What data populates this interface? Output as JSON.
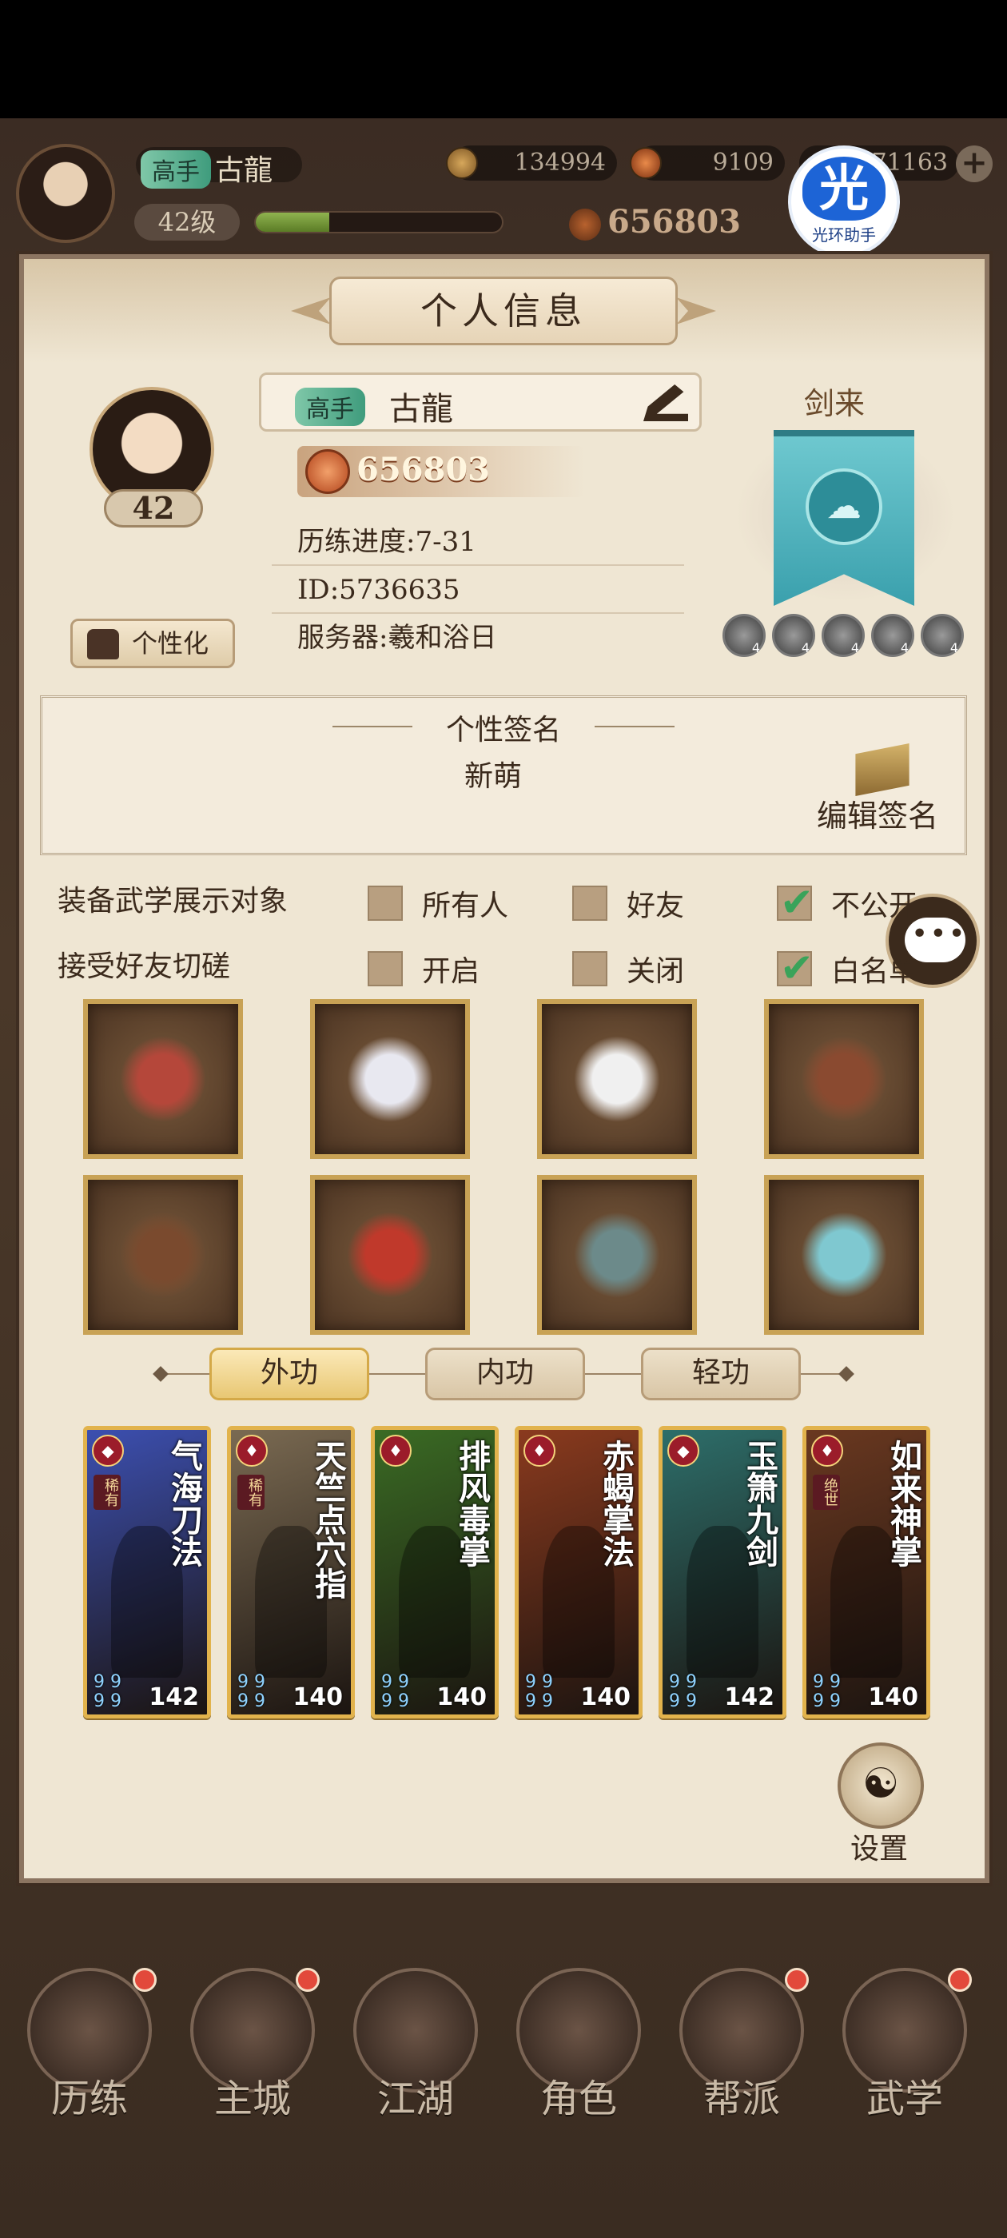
{
  "hud": {
    "rank_badge": "高手",
    "player_name": "古龍",
    "level": "42级",
    "exp_fraction": 0.3,
    "coins": "134994",
    "gems": "9109",
    "tokens": "71163",
    "power": "656803",
    "helper_glyph": "光",
    "helper_label": "光环助手"
  },
  "panel": {
    "title": "个人信息",
    "avatar_level": "42",
    "customize_label": "个性化",
    "rank_badge": "高手",
    "name": "古龍",
    "power": "656803",
    "progress": "历练进度:7-31",
    "id": "ID:5736635",
    "server": "服务器:羲和浴日",
    "sect": {
      "name": "剑来",
      "skill_levels": [
        "4",
        "4",
        "4",
        "4",
        "4"
      ]
    },
    "signature": {
      "title": "个性签名",
      "text": "新萌",
      "edit_label": "编辑签名"
    },
    "options": [
      {
        "label": "装备武学展示对象",
        "choices": [
          {
            "text": "所有人",
            "checked": false
          },
          {
            "text": "好友",
            "checked": false
          },
          {
            "text": "不公开",
            "checked": true
          }
        ]
      },
      {
        "label": "接受好友切磋",
        "choices": [
          {
            "text": "开启",
            "checked": false
          },
          {
            "text": "关闭",
            "checked": false
          },
          {
            "text": "白名单",
            "checked": true
          }
        ]
      }
    ],
    "equipment": [
      "bracer-icon",
      "robe-icon",
      "belt-icon",
      "boots-icon",
      "necklace-icon",
      "hairpin-icon",
      "bracelet-icon",
      "ring-icon"
    ],
    "tabs": [
      {
        "label": "外功",
        "active": true
      },
      {
        "label": "内功",
        "active": false
      },
      {
        "label": "轻功",
        "active": false
      }
    ],
    "cards": [
      {
        "name": "气海刀法",
        "tag": "稀有",
        "level": "142",
        "color": "#3c4fb0"
      },
      {
        "name": "天竺点穴指",
        "tag": "稀有",
        "level": "140",
        "color": "#7a6a52"
      },
      {
        "name": "排风毒掌",
        "tag": "",
        "level": "140",
        "color": "#3a6b24"
      },
      {
        "name": "赤蝎掌法",
        "tag": "",
        "level": "140",
        "color": "#8a3a1e"
      },
      {
        "name": "玉箫九剑",
        "tag": "",
        "level": "142",
        "color": "#2d6e6a"
      },
      {
        "name": "如来神掌",
        "tag": "绝世",
        "level": "140",
        "color": "#6a3820"
      }
    ],
    "settings_label": "设置"
  },
  "nav": [
    {
      "label": "历练",
      "badge": true
    },
    {
      "label": "主城",
      "badge": true
    },
    {
      "label": "江湖",
      "badge": false
    },
    {
      "label": "角色",
      "badge": false
    },
    {
      "label": "帮派",
      "badge": true
    },
    {
      "label": "武学",
      "badge": true
    }
  ],
  "colors": {
    "panel_bg": "#efe6d3",
    "accent_gold": "#e2b34c",
    "check_green": "#3aa35a",
    "badge_red": "#e2493b"
  }
}
